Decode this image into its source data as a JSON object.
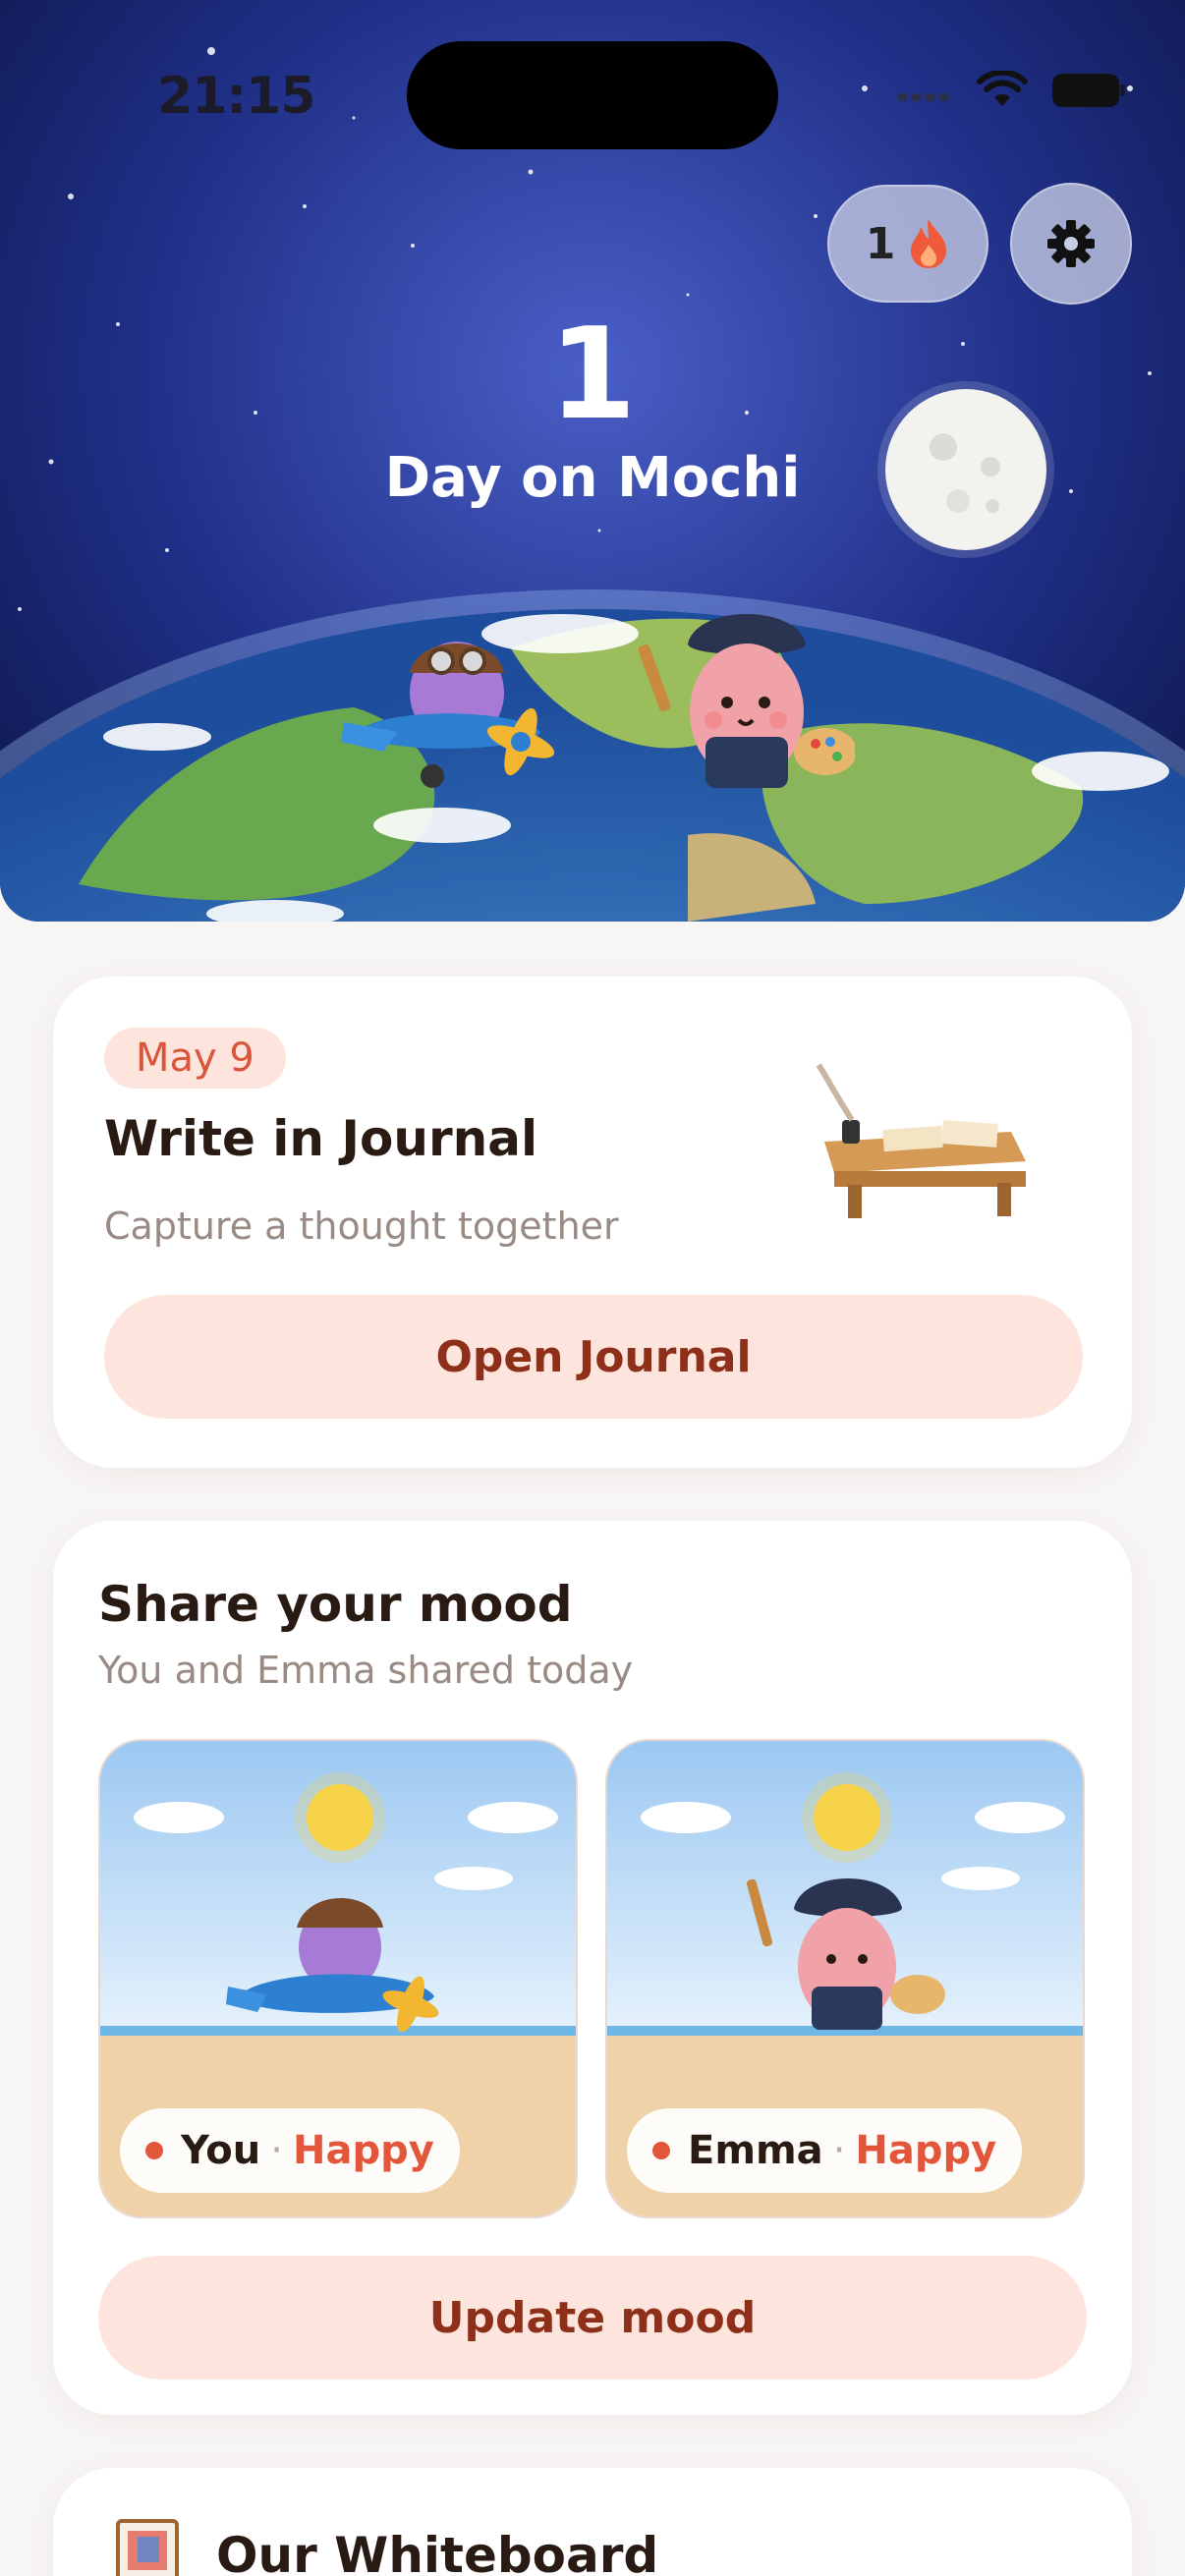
{
  "status_bar": {
    "time": "21:15"
  },
  "header": {
    "streak_count": "1",
    "day_number": "1",
    "day_label": "Day on Mochi"
  },
  "journal": {
    "date": "May 9",
    "title": "Write in Journal",
    "subtitle": "Capture a thought together",
    "button_label": "Open Journal"
  },
  "mood": {
    "title": "Share your mood",
    "subtitle": "You and Emma shared today",
    "entries": [
      {
        "name": "You",
        "separator": "·",
        "mood": "Happy"
      },
      {
        "name": "Emma",
        "separator": "·",
        "mood": "Happy"
      }
    ],
    "button_label": "Update mood"
  },
  "whiteboard": {
    "title": "Our Whiteboard"
  },
  "colors": {
    "accent": "#e2563c",
    "button_bg": "#fde5de",
    "button_text": "#8e2f1a"
  }
}
